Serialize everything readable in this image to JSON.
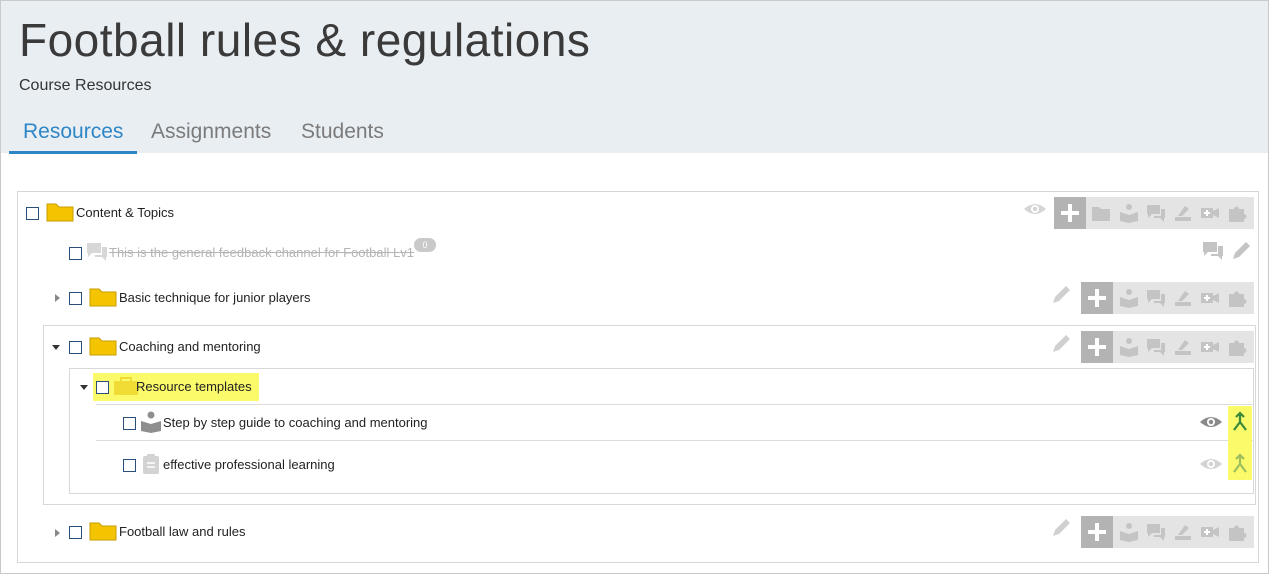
{
  "header": {
    "title": "Football rules & regulations",
    "subtitle": "Course Resources"
  },
  "tabs": [
    {
      "label": "Resources",
      "active": true
    },
    {
      "label": "Assignments",
      "active": false
    },
    {
      "label": "Students",
      "active": false
    }
  ],
  "tree": {
    "root": {
      "label": "Content & Topics"
    },
    "feedback_channel": {
      "label": "This is the general feedback channel for Football Lv1",
      "count": "0"
    },
    "folder_basic": {
      "label": "Basic technique for junior players"
    },
    "folder_coaching": {
      "label": "Coaching and mentoring"
    },
    "folder_templates": {
      "label": "Resource templates"
    },
    "item_guide": {
      "label": "Step by step guide to coaching and mentoring"
    },
    "item_learning": {
      "label": "effective professional learning"
    },
    "folder_law": {
      "label": "Football law and rules"
    }
  },
  "colors": {
    "accent": "#2f86c6",
    "header_bg": "#e9eef3",
    "folder": "#f5c400",
    "highlight": "#fafa6a",
    "icon_gray": "#c4c4c4"
  }
}
